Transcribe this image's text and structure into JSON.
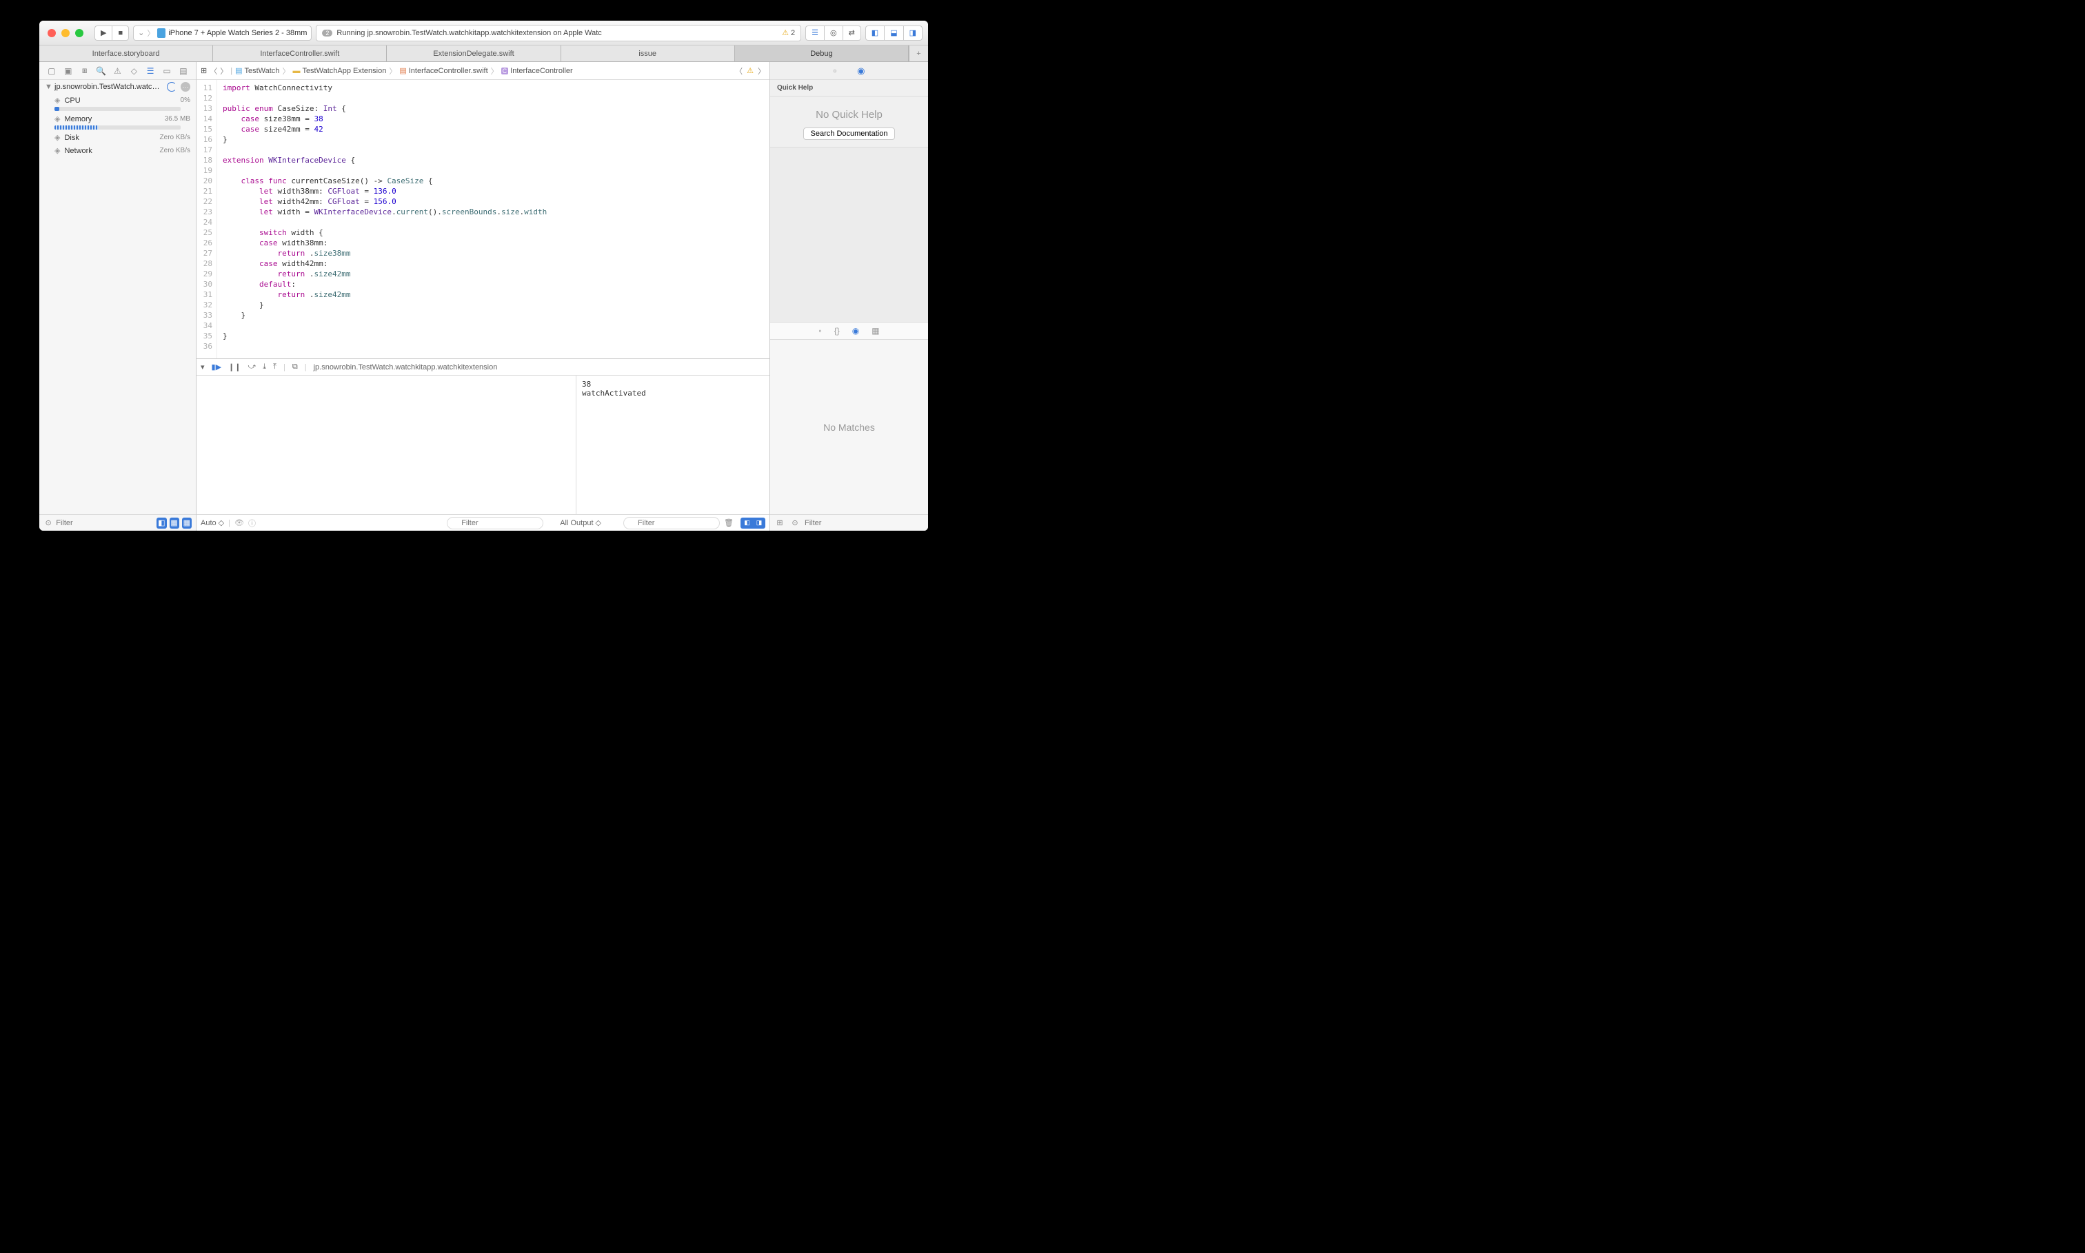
{
  "scheme": {
    "target": "iPhone 7 + Apple Watch Series 2 - 38mm"
  },
  "status": {
    "issue_count": "2",
    "text": "Running jp.snowrobin.TestWatch.watchkitapp.watchkitextension on Apple Watc",
    "warn_count": "2"
  },
  "tabs": [
    {
      "label": "Interface.storyboard",
      "active": false
    },
    {
      "label": "InterfaceController.swift",
      "active": false
    },
    {
      "label": "ExtensionDelegate.swift",
      "active": false
    },
    {
      "label": "issue",
      "active": false
    },
    {
      "label": "Debug",
      "active": true
    }
  ],
  "navigator": {
    "process": "jp.snowrobin.TestWatch.watchkit...",
    "items": [
      {
        "name": "CPU",
        "value": "0%",
        "icon": "cpu-icon"
      },
      {
        "name": "Memory",
        "value": "36.5 MB",
        "icon": "memory-icon"
      },
      {
        "name": "Disk",
        "value": "Zero KB/s",
        "icon": "disk-icon"
      },
      {
        "name": "Network",
        "value": "Zero KB/s",
        "icon": "network-icon"
      }
    ],
    "filter_placeholder": "Filter"
  },
  "jumpbar": {
    "crumbs": [
      "TestWatch",
      "TestWatchApp Extension",
      "InterfaceController.swift",
      "InterfaceController"
    ]
  },
  "code": {
    "first_line": 11,
    "lines": [
      [
        {
          "t": "import ",
          "c": "kw"
        },
        {
          "t": "WatchConnectivity",
          "c": ""
        }
      ],
      [],
      [
        {
          "t": "public enum ",
          "c": "kw"
        },
        {
          "t": "CaseSize",
          "c": ""
        },
        {
          "t": ": ",
          "c": ""
        },
        {
          "t": "Int",
          "c": "type"
        },
        {
          "t": " {",
          "c": ""
        }
      ],
      [
        {
          "t": "    ",
          "c": ""
        },
        {
          "t": "case",
          "c": "kw"
        },
        {
          "t": " size38mm = ",
          "c": ""
        },
        {
          "t": "38",
          "c": "num"
        }
      ],
      [
        {
          "t": "    ",
          "c": ""
        },
        {
          "t": "case",
          "c": "kw"
        },
        {
          "t": " size42mm = ",
          "c": ""
        },
        {
          "t": "42",
          "c": "num"
        }
      ],
      [
        {
          "t": "}",
          "c": ""
        }
      ],
      [],
      [
        {
          "t": "extension ",
          "c": "kw"
        },
        {
          "t": "WKInterfaceDevice",
          "c": "type"
        },
        {
          "t": " {",
          "c": ""
        }
      ],
      [],
      [
        {
          "t": "    ",
          "c": ""
        },
        {
          "t": "class func",
          "c": "kw"
        },
        {
          "t": " currentCaseSize() -> ",
          "c": ""
        },
        {
          "t": "CaseSize",
          "c": "ident"
        },
        {
          "t": " {",
          "c": ""
        }
      ],
      [
        {
          "t": "        ",
          "c": ""
        },
        {
          "t": "let",
          "c": "kw"
        },
        {
          "t": " width38mm: ",
          "c": ""
        },
        {
          "t": "CGFloat",
          "c": "type"
        },
        {
          "t": " = ",
          "c": ""
        },
        {
          "t": "136.0",
          "c": "num"
        }
      ],
      [
        {
          "t": "        ",
          "c": ""
        },
        {
          "t": "let",
          "c": "kw"
        },
        {
          "t": " width42mm: ",
          "c": ""
        },
        {
          "t": "CGFloat",
          "c": "type"
        },
        {
          "t": " = ",
          "c": ""
        },
        {
          "t": "156.0",
          "c": "num"
        }
      ],
      [
        {
          "t": "        ",
          "c": ""
        },
        {
          "t": "let",
          "c": "kw"
        },
        {
          "t": " width = ",
          "c": ""
        },
        {
          "t": "WKInterfaceDevice",
          "c": "type"
        },
        {
          "t": ".",
          "c": ""
        },
        {
          "t": "current",
          "c": "ident"
        },
        {
          "t": "().",
          "c": ""
        },
        {
          "t": "screenBounds",
          "c": "ident"
        },
        {
          "t": ".",
          "c": ""
        },
        {
          "t": "size",
          "c": "ident"
        },
        {
          "t": ".",
          "c": ""
        },
        {
          "t": "width",
          "c": "ident"
        }
      ],
      [],
      [
        {
          "t": "        ",
          "c": ""
        },
        {
          "t": "switch",
          "c": "kw"
        },
        {
          "t": " width {",
          "c": ""
        }
      ],
      [
        {
          "t": "        ",
          "c": ""
        },
        {
          "t": "case",
          "c": "kw"
        },
        {
          "t": " width38mm:",
          "c": ""
        }
      ],
      [
        {
          "t": "            ",
          "c": ""
        },
        {
          "t": "return",
          "c": "kw"
        },
        {
          "t": " .",
          "c": ""
        },
        {
          "t": "size38mm",
          "c": "ident"
        }
      ],
      [
        {
          "t": "        ",
          "c": ""
        },
        {
          "t": "case",
          "c": "kw"
        },
        {
          "t": " width42mm:",
          "c": ""
        }
      ],
      [
        {
          "t": "            ",
          "c": ""
        },
        {
          "t": "return",
          "c": "kw"
        },
        {
          "t": " .",
          "c": ""
        },
        {
          "t": "size42mm",
          "c": "ident"
        }
      ],
      [
        {
          "t": "        ",
          "c": ""
        },
        {
          "t": "default",
          "c": "kw"
        },
        {
          "t": ":",
          "c": ""
        }
      ],
      [
        {
          "t": "            ",
          "c": ""
        },
        {
          "t": "return",
          "c": "kw"
        },
        {
          "t": " .",
          "c": ""
        },
        {
          "t": "size42mm",
          "c": "ident"
        }
      ],
      [
        {
          "t": "        }",
          "c": ""
        }
      ],
      [
        {
          "t": "    }",
          "c": ""
        }
      ],
      [],
      [
        {
          "t": "}",
          "c": ""
        }
      ],
      []
    ]
  },
  "debug": {
    "process_label": "jp.snowrobin.TestWatch.watchkitapp.watchkitextension",
    "console": "38\nwatchActivated",
    "auto_label": "Auto ◇",
    "all_output_label": "All Output ◇",
    "filter_placeholder": "Filter"
  },
  "inspector": {
    "quick_help_title": "Quick Help",
    "no_quick_help": "No Quick Help",
    "search_doc": "Search Documentation",
    "no_matches": "No Matches",
    "filter_placeholder": "Filter"
  }
}
